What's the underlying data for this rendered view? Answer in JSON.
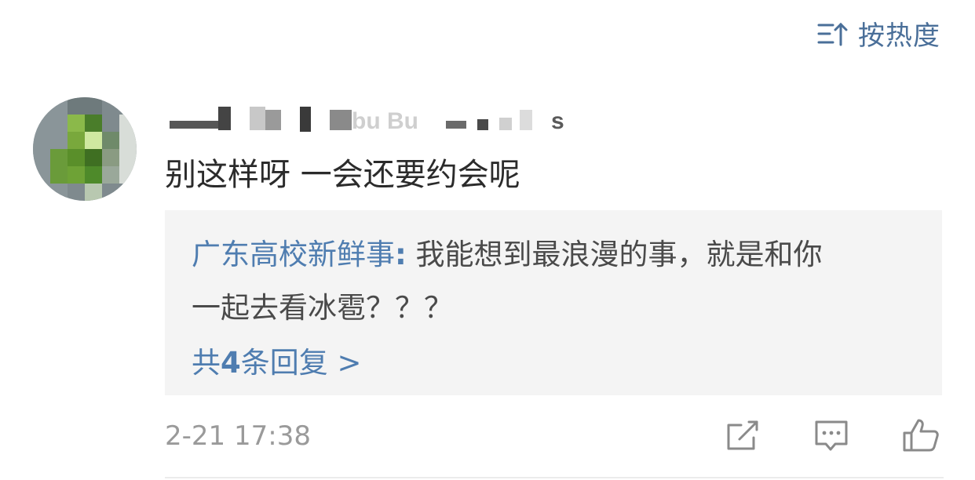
{
  "sort": {
    "label": "按热度",
    "icon": "sort-icon"
  },
  "comment": {
    "username": "▇▇ ▇▇ ▇▇bu Bu▇ ▇▇s",
    "text": "别这样呀 一会还要约会呢",
    "timestamp": "2-21 17:38"
  },
  "reply": {
    "author": "广东高校新鲜事",
    "colon": ":",
    "line1": " 我能想到最浪漫的事，就是和你",
    "line2": "一起去看冰雹？？？",
    "more_prefix": "共",
    "more_count": "4",
    "more_suffix": "条回复 >"
  },
  "actions": [
    {
      "name": "forward",
      "icon": "share-icon"
    },
    {
      "name": "comment",
      "icon": "comment-icon"
    },
    {
      "name": "like",
      "icon": "thumbs-up-icon"
    }
  ],
  "colors": {
    "link": "#4f7db0",
    "reply_bg": "#f4f4f4",
    "muted": "#9a9a9a"
  }
}
